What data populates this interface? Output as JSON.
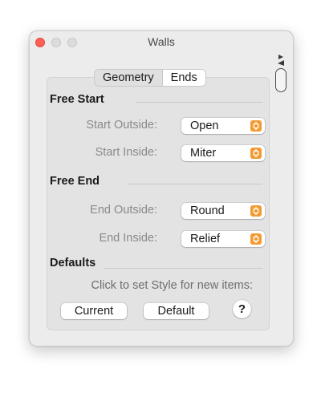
{
  "window": {
    "title": "Walls"
  },
  "tabs": [
    {
      "label": "Geometry",
      "selected": false
    },
    {
      "label": "Ends",
      "selected": true
    }
  ],
  "free_start": {
    "title": "Free Start",
    "rows": [
      {
        "label": "Start Outside:",
        "value": "Open"
      },
      {
        "label": "Start Inside:",
        "value": "Miter"
      }
    ]
  },
  "free_end": {
    "title": "Free End",
    "rows": [
      {
        "label": "End Outside:",
        "value": "Round"
      },
      {
        "label": "End Inside:",
        "value": "Relief"
      }
    ]
  },
  "defaults": {
    "title": "Defaults",
    "hint": "Click to set Style for new items:",
    "current_label": "Current",
    "default_label": "Default",
    "help_label": "?"
  },
  "colors": {
    "accent": "#f39a30",
    "close": "#ff5f57",
    "window_bg": "#ececec",
    "panel_bg": "#e3e3e3"
  },
  "icons": {
    "pin": "pin-icon",
    "popup_arrow": "chevron-updown-icon",
    "help": "help-icon"
  }
}
